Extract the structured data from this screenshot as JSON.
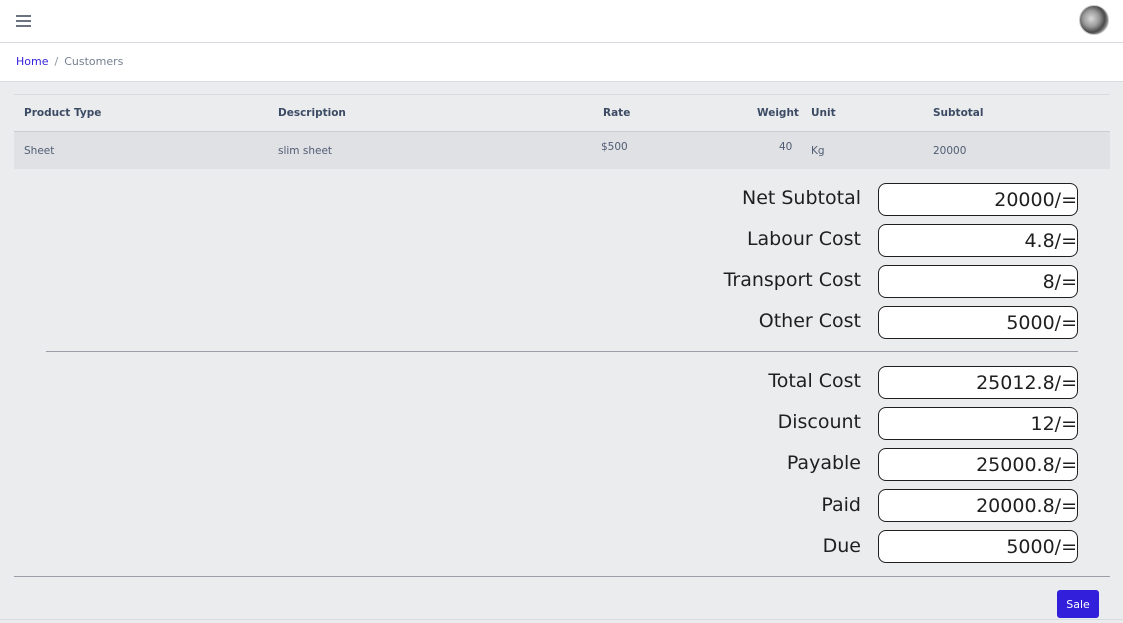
{
  "header": {
    "menu_icon": "hamburger-icon",
    "avatar_icon": "user-avatar"
  },
  "breadcrumb": {
    "home": "Home",
    "separator": "/",
    "current": "Customers"
  },
  "table": {
    "columns": {
      "product_type": "Product Type",
      "description": "Description",
      "rate": "Rate",
      "weight": "Weight",
      "unit": "Unit",
      "subtotal": "Subtotal"
    },
    "rows": [
      {
        "product_type": "Sheet",
        "description": "slim sheet",
        "rate": "$500",
        "weight": "40",
        "unit": "Kg",
        "subtotal": "20000"
      }
    ]
  },
  "summary": {
    "net_subtotal": {
      "label": "Net Subtotal",
      "value": "20000/="
    },
    "labour_cost": {
      "label": "Labour Cost",
      "value": "4.8/="
    },
    "transport_cost": {
      "label": "Transport Cost",
      "value": "8/="
    },
    "other_cost": {
      "label": "Other Cost",
      "value": "5000/="
    },
    "total_cost": {
      "label": "Total Cost",
      "value": "25012.8/="
    },
    "discount": {
      "label": "Discount",
      "value": "12/="
    },
    "payable": {
      "label": "Payable",
      "value": "25000.8/="
    },
    "paid": {
      "label": "Paid",
      "value": "20000.8/="
    },
    "due": {
      "label": "Due",
      "value": "5000/="
    }
  },
  "actions": {
    "sale_label": "Sale"
  },
  "colors": {
    "primary": "#321fdb",
    "background": "#ebecee"
  }
}
